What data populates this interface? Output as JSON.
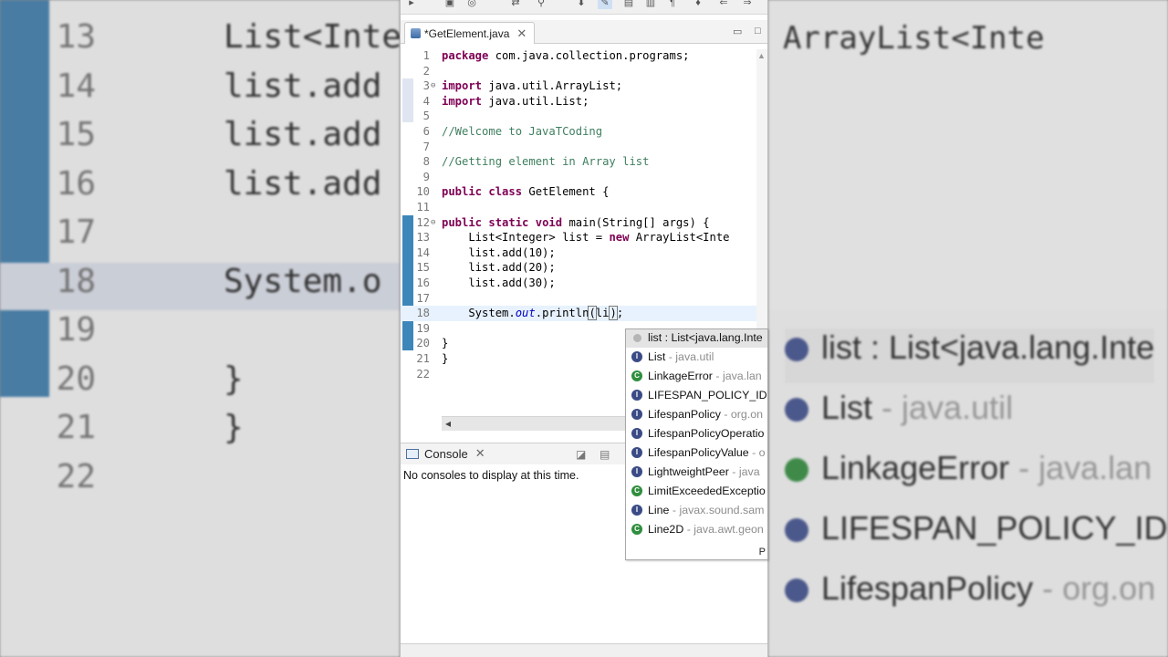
{
  "editor": {
    "tab_title": "*GetElement.java",
    "lines": [
      {
        "n": "1",
        "fold": "",
        "parts": [
          {
            "t": "package",
            "c": "kw"
          },
          {
            "t": " com.java.collection.programs;",
            "c": ""
          }
        ]
      },
      {
        "n": "2",
        "fold": "",
        "parts": []
      },
      {
        "n": "3",
        "fold": "⊖",
        "parts": [
          {
            "t": "import",
            "c": "kw"
          },
          {
            "t": " java.util.ArrayList;",
            "c": ""
          }
        ]
      },
      {
        "n": "4",
        "fold": "",
        "parts": [
          {
            "t": "import",
            "c": "kw"
          },
          {
            "t": " java.util.List;",
            "c": ""
          }
        ]
      },
      {
        "n": "5",
        "fold": "",
        "parts": []
      },
      {
        "n": "6",
        "fold": "",
        "parts": [
          {
            "t": "//Welcome to JavaTCoding",
            "c": "cm"
          }
        ]
      },
      {
        "n": "7",
        "fold": "",
        "parts": []
      },
      {
        "n": "8",
        "fold": "",
        "parts": [
          {
            "t": "//Getting element in Array list",
            "c": "cm"
          }
        ]
      },
      {
        "n": "9",
        "fold": "",
        "parts": []
      },
      {
        "n": "10",
        "fold": "",
        "parts": [
          {
            "t": "public",
            "c": "kw"
          },
          {
            "t": " ",
            "c": ""
          },
          {
            "t": "class",
            "c": "kw"
          },
          {
            "t": " GetElement {",
            "c": ""
          }
        ]
      },
      {
        "n": "11",
        "fold": "",
        "parts": []
      },
      {
        "n": "12",
        "fold": "⊖",
        "parts": [
          {
            "t": "public",
            "c": "kw"
          },
          {
            "t": " ",
            "c": ""
          },
          {
            "t": "static",
            "c": "kw"
          },
          {
            "t": " ",
            "c": ""
          },
          {
            "t": "void",
            "c": "kw"
          },
          {
            "t": " main(String[] args) {",
            "c": ""
          }
        ]
      },
      {
        "n": "13",
        "fold": "",
        "parts": [
          {
            "t": "    List<Integer> list = ",
            "c": ""
          },
          {
            "t": "new",
            "c": "kw"
          },
          {
            "t": " ArrayList<Inte",
            "c": ""
          }
        ]
      },
      {
        "n": "14",
        "fold": "",
        "parts": [
          {
            "t": "    list.add(10);",
            "c": ""
          }
        ]
      },
      {
        "n": "15",
        "fold": "",
        "parts": [
          {
            "t": "    list.add(20);",
            "c": ""
          }
        ]
      },
      {
        "n": "16",
        "fold": "",
        "parts": [
          {
            "t": "    list.add(30);",
            "c": ""
          }
        ]
      },
      {
        "n": "17",
        "fold": "",
        "parts": []
      },
      {
        "n": "18",
        "fold": "",
        "parts": [
          {
            "t": "    System.",
            "c": ""
          },
          {
            "t": "out",
            "c": "it"
          },
          {
            "t": ".println",
            "c": ""
          },
          {
            "t": "(",
            "c": "brk"
          },
          {
            "t": "li",
            "c": ""
          },
          {
            "t": "CARET",
            "c": "caret"
          },
          {
            "t": ")",
            "c": "brk"
          },
          {
            "t": ";",
            "c": ""
          }
        ]
      },
      {
        "n": "19",
        "fold": "",
        "parts": []
      },
      {
        "n": "20",
        "fold": "",
        "parts": [
          {
            "t": "}",
            "c": ""
          }
        ]
      },
      {
        "n": "21",
        "fold": "",
        "parts": [
          {
            "t": "}",
            "c": ""
          }
        ]
      },
      {
        "n": "22",
        "fold": "",
        "parts": []
      }
    ]
  },
  "console": {
    "tab_label": "Console",
    "message": "No consoles to display at this time."
  },
  "content_assist": {
    "items": [
      {
        "icon": "v",
        "name": "list : List<java.lang.Inte",
        "pkg": ""
      },
      {
        "icon": "i",
        "name": "List",
        "pkg": " - java.util"
      },
      {
        "icon": "c",
        "name": "LinkageError",
        "pkg": " - java.lan"
      },
      {
        "icon": "i",
        "name": "LIFESPAN_POLICY_ID",
        "pkg": " -"
      },
      {
        "icon": "i",
        "name": "LifespanPolicy",
        "pkg": " - org.on"
      },
      {
        "icon": "i",
        "name": "LifespanPolicyOperatio",
        "pkg": ""
      },
      {
        "icon": "i",
        "name": "LifespanPolicyValue",
        "pkg": " - o"
      },
      {
        "icon": "i",
        "name": "LightweightPeer",
        "pkg": " - java"
      },
      {
        "icon": "c",
        "name": "LimitExceededExceptio",
        "pkg": ""
      },
      {
        "icon": "i",
        "name": "Line",
        "pkg": " - javax.sound.sam"
      },
      {
        "icon": "c",
        "name": "Line2D",
        "pkg": " - java.awt.geon"
      }
    ],
    "footer_letter": "P"
  },
  "background": {
    "left_lines": [
      {
        "n": "13",
        "t": "List<Inte"
      },
      {
        "n": "14",
        "t": "list.add"
      },
      {
        "n": "15",
        "t": "list.add"
      },
      {
        "n": "16",
        "t": "list.add"
      },
      {
        "n": "17",
        "t": ""
      },
      {
        "n": "18",
        "t": "System.o"
      },
      {
        "n": "19",
        "t": ""
      },
      {
        "n": "20",
        "t": "}"
      },
      {
        "n": "21",
        "t": "}"
      },
      {
        "n": "22",
        "t": ""
      }
    ],
    "right_top": "ArrayList<Inte",
    "right_items": [
      {
        "name": "list : List<java.lang.Inte",
        "pkg": ""
      },
      {
        "name": "List",
        "pkg": " - java.util"
      },
      {
        "name": "LinkageError",
        "pkg": " - java.lan"
      },
      {
        "name": "LIFESPAN_POLICY_ID",
        "pkg": " -"
      },
      {
        "name": "LifespanPolicy",
        "pkg": " - org.on"
      }
    ]
  }
}
